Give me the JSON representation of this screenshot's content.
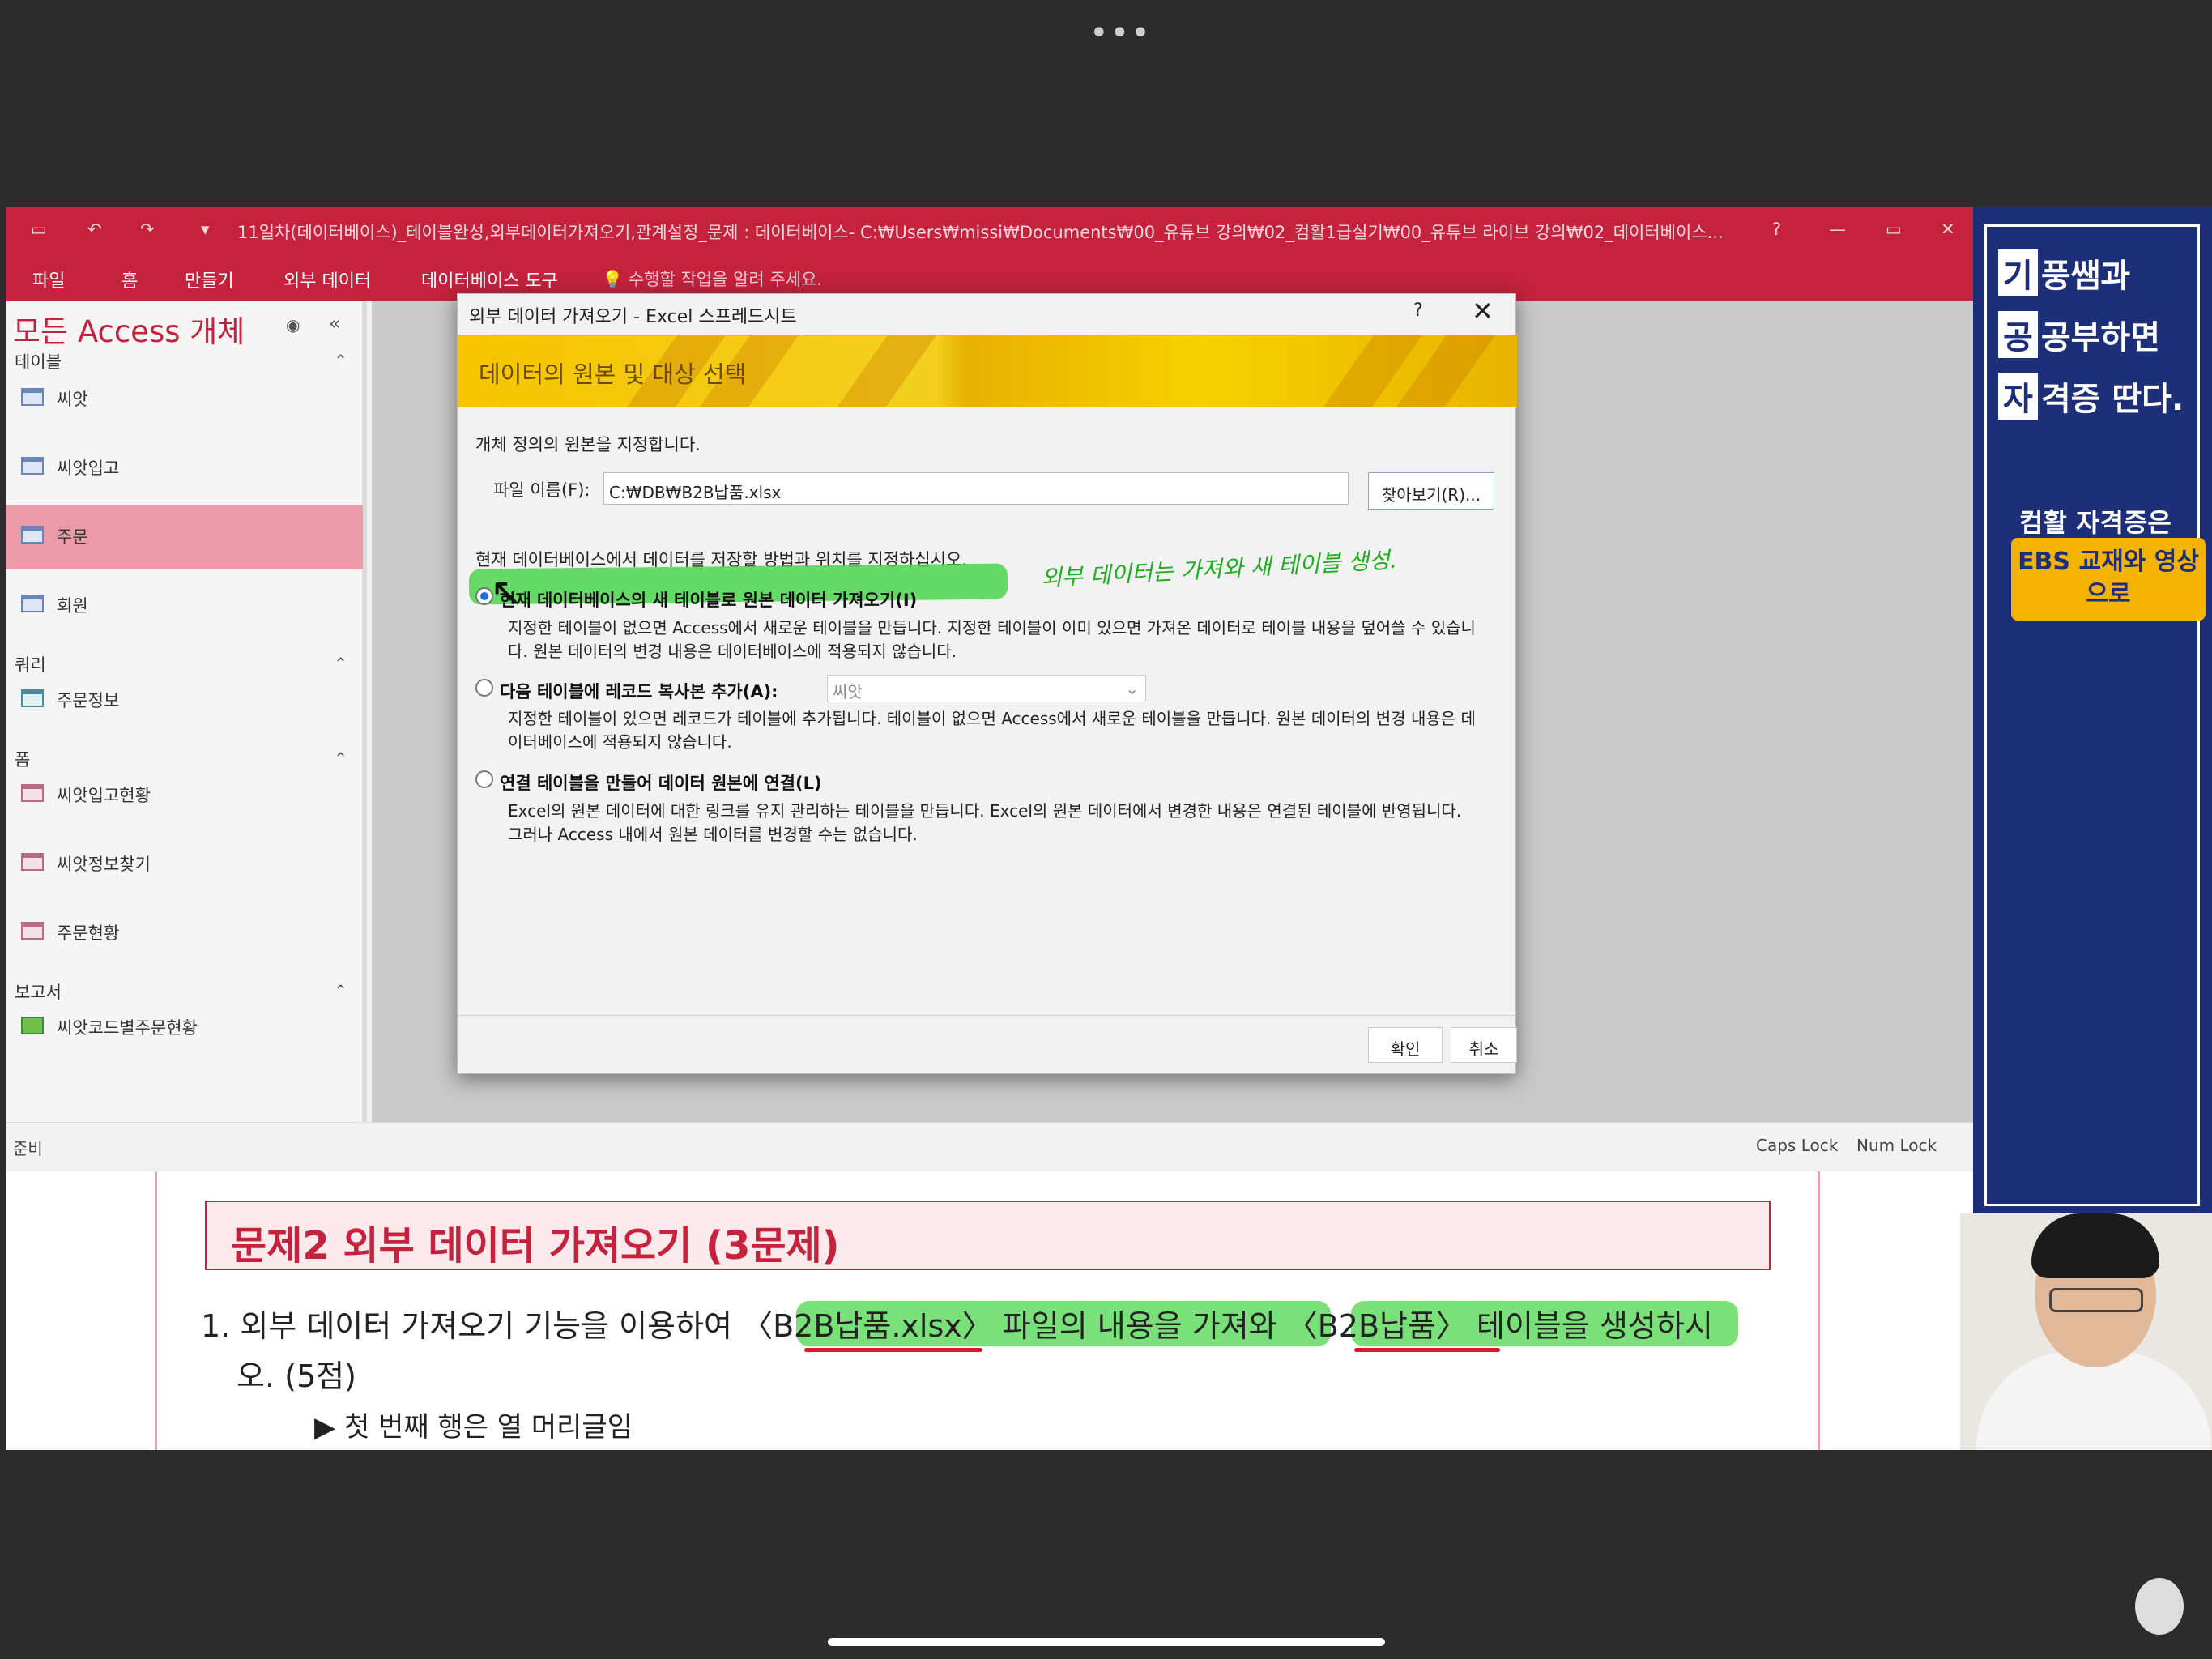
{
  "top_overlay": {
    "dots": "•••"
  },
  "access": {
    "title": "11일차(데이터베이스)_테이블완성,외부데이터가져오기,관계설정_문제 : 데이터베이스- C:₩Users₩missi₩Documents₩00_유튜브 강의₩02_컴활1급실기₩00_유튜브 라이브 강의₩02_데이터베이스...",
    "help": "?",
    "ribbon_tabs": [
      "파일",
      "홈",
      "만들기",
      "외부 데이터",
      "데이터베이스 도구"
    ],
    "tell_me": "수행할 작업을 알려 주세요.",
    "nav": {
      "title": "모든 Access 개체",
      "sections": {
        "tables": {
          "label": "테이블",
          "items": [
            "씨앗",
            "씨앗입고",
            "주문",
            "회원"
          ]
        },
        "queries": {
          "label": "쿼리",
          "items": [
            "주문정보"
          ]
        },
        "forms": {
          "label": "폼",
          "items": [
            "씨앗입고현황",
            "씨앗정보찾기",
            "주문현황"
          ]
        },
        "reports": {
          "label": "보고서",
          "items": [
            "씨앗코드별주문현황"
          ]
        }
      },
      "selected": "주문"
    },
    "status": {
      "left": "준비",
      "caps": "Caps Lock",
      "num": "Num Lock"
    }
  },
  "dialog": {
    "title": "외부 데이터 가져오기 - Excel 스프레드시트",
    "help": "?",
    "close": "✕",
    "banner": "데이터의 원본 및 대상 선택",
    "spec_label": "개체 정의의 원본을 지정합니다.",
    "file_label": "파일 이름(F):",
    "file_value": "C:₩DB₩B2B납품.xlsx",
    "browse": "찾아보기(R)...",
    "store_label": "현재 데이터베이스에서 데이터를 저장할 방법과 위치를 지정하십시오.",
    "options": [
      {
        "title": "현재 데이터베이스의 새 테이블로 원본 데이터 가져오기(I)",
        "desc": "지정한 테이블이 없으면 Access에서 새로운 테이블을 만듭니다. 지정한 테이블이 이미 있으면 가져온 데이터로 테이블 내용을 덮어쓸 수 있습니다. 원본 데이터의 변경 내용은 데이터베이스에 적용되지 않습니다.",
        "checked": true
      },
      {
        "title": "다음 테이블에 레코드 복사본 추가(A):",
        "desc": "지정한 테이블이 있으면 레코드가 테이블에 추가됩니다. 테이블이 없으면 Access에서 새로운 테이블을 만듭니다. 원본 데이터의 변경 내용은 데이터베이스에 적용되지 않습니다.",
        "checked": false,
        "select_value": "씨앗"
      },
      {
        "title": "연결 테이블을 만들어 데이터 원본에 연결(L)",
        "desc": "Excel의 원본 데이터에 대한 링크를 유지 관리하는 테이블을 만듭니다. Excel의 원본 데이터에서 변경한 내용은 연결된 테이블에 반영됩니다. 그러나 Access 내에서 원본 데이터를 변경할 수는 없습니다.",
        "checked": false
      }
    ],
    "ok": "확인",
    "cancel": "취소",
    "handwritten_note": "외부 데이터는 가져와 새 테이블 생성."
  },
  "document": {
    "problem_title": "문제2 외부 데이터 가져오기 (3문제)",
    "q1_prefix": "1. 외부 데이터 가져오기 기능을 이용하여 ",
    "q1_file": "〈B2B납품.xlsx〉",
    "q1_mid": " 파일의 내용을 가져와 ",
    "q1_table": "〈B2B납품〉",
    "q1_end_hl": " 테이블을 생성",
    "q1_end": "하시",
    "q1_line2": "오. (5점)",
    "bullet": "▶ 첫 번째 행은 열 머리글임"
  },
  "side_banner": {
    "lines": [
      {
        "box": "기",
        "rest": "풍쌤과"
      },
      {
        "box": "공",
        "rest": "공부하면"
      },
      {
        "box": "자",
        "rest": "격증 딴다."
      }
    ],
    "sub": "컴활 자격증은",
    "ebs": "EBS 교재와 영상으로"
  },
  "colors": {
    "access_red": "#c4223d",
    "highlight_green": "#4ed64e",
    "banner_yellow": "#f6c400",
    "side_navy": "#1e2f7a"
  }
}
